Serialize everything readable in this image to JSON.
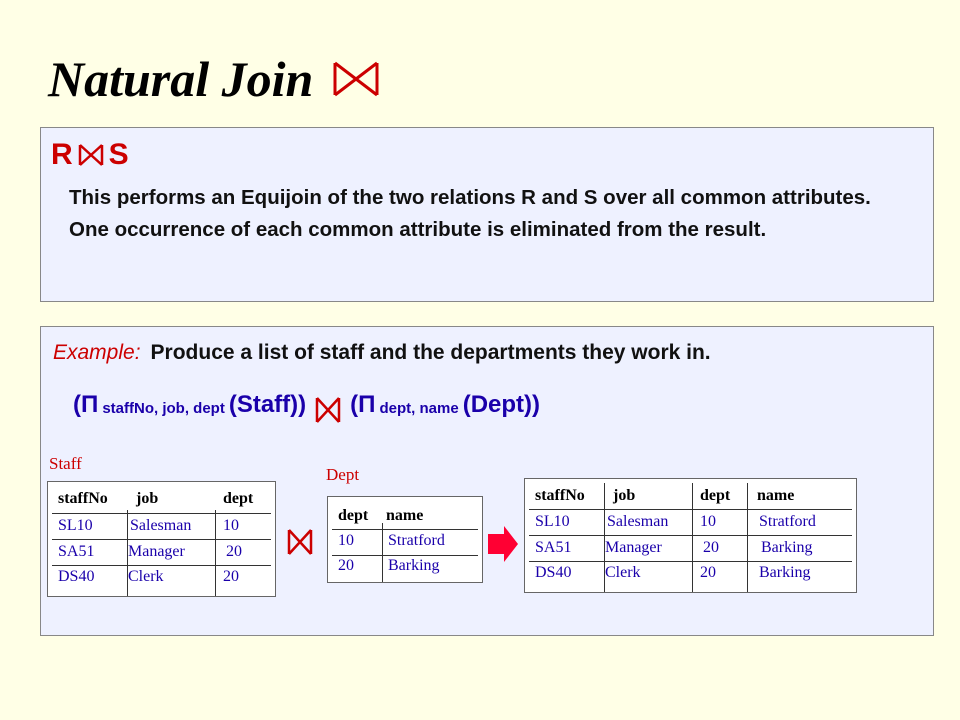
{
  "title": "Natural Join",
  "box1": {
    "expression_left": "R",
    "expression_right": "S",
    "description": "This performs an Equijoin of the two relations R and S over all common attributes. One occurrence of each common attribute is eliminated from the result."
  },
  "box2": {
    "example_label": "Example:",
    "example_text": "Produce a list of staff and the departments they work in.",
    "expr": {
      "open1": "(",
      "pi1": "Π",
      "attrs1": "staffNo, job, dept",
      "rel1": "(Staff)",
      "close1": ")",
      "open2": "(",
      "pi2": "Π",
      "attrs2": "dept, name",
      "rel2": "(Dept)",
      "close2": ")"
    }
  },
  "staff": {
    "label": "Staff",
    "columns": [
      "staffNo",
      "job",
      "dept"
    ],
    "rows": [
      [
        "SL10",
        "Salesman",
        "10"
      ],
      [
        "SA51",
        "Manager",
        "20"
      ],
      [
        "DS40",
        "Clerk",
        "20"
      ]
    ]
  },
  "dept": {
    "label": "Dept",
    "columns": [
      "dept",
      "name"
    ],
    "rows": [
      [
        "10",
        "Stratford"
      ],
      [
        "20",
        "Barking"
      ]
    ]
  },
  "result": {
    "columns": [
      "staffNo",
      "job",
      "dept",
      "name"
    ],
    "rows": [
      [
        "SL10",
        "Salesman",
        "10",
        "Stratford"
      ],
      [
        "SA51",
        "Manager",
        "20",
        "Barking"
      ],
      [
        "DS40",
        "Clerk",
        "20",
        "Barking"
      ]
    ]
  },
  "colors": {
    "accent_red": "#cc0000",
    "text_blue": "#1a00aa",
    "box_bg": "#eef1ff",
    "page_bg": "#ffffe6"
  },
  "icons": [
    "bowtie-join-icon",
    "right-arrow-icon"
  ]
}
